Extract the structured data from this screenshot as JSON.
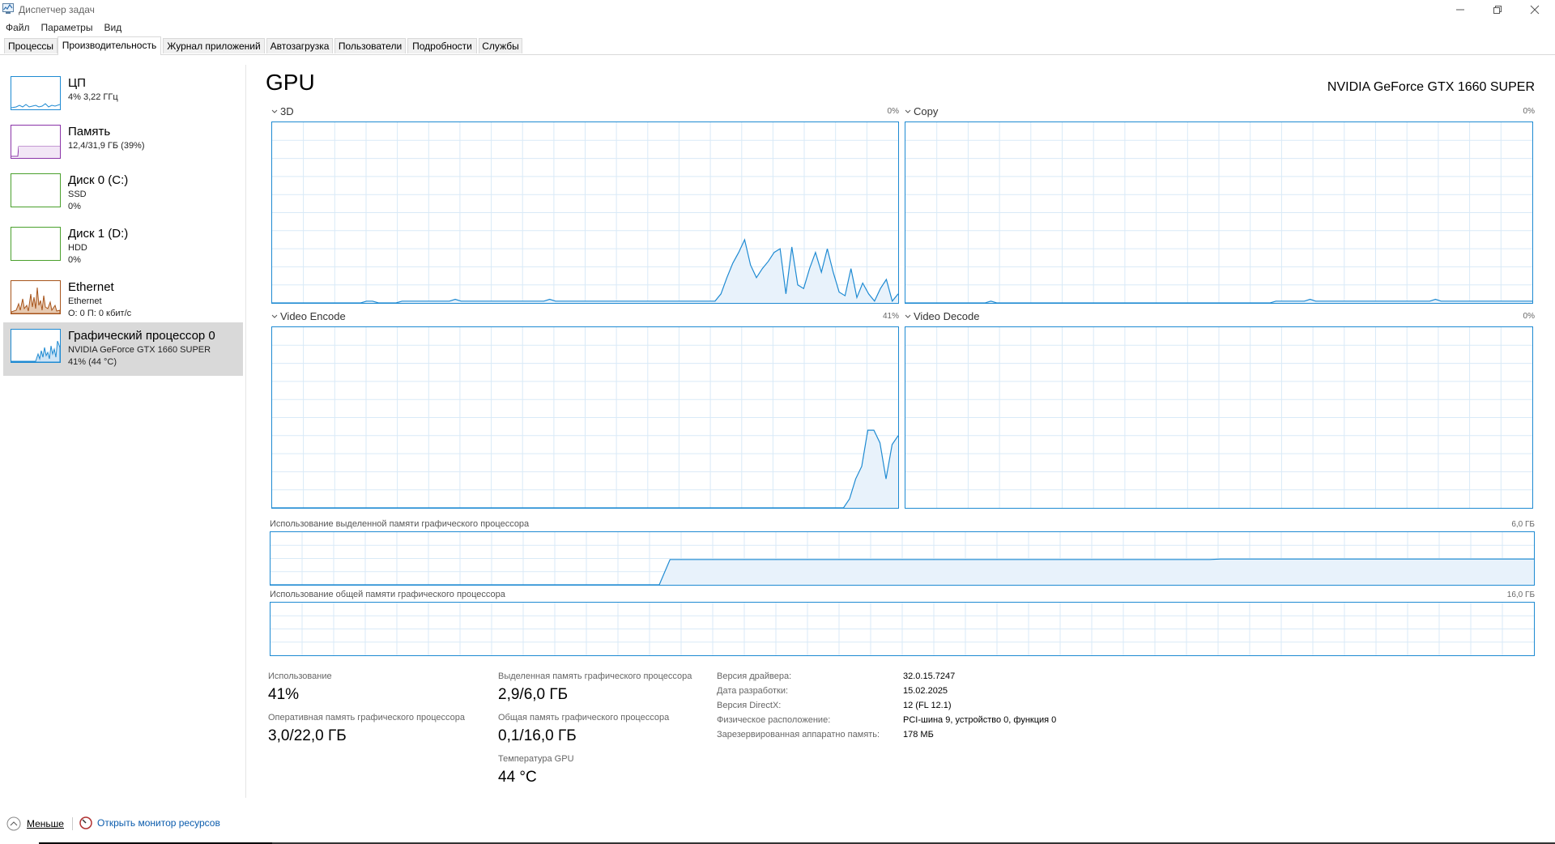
{
  "window": {
    "title": "Диспетчер задач",
    "menu": [
      "Файл",
      "Параметры",
      "Вид"
    ],
    "accent": "#1e8ad2"
  },
  "tabs": [
    "Процессы",
    "Производительность",
    "Журнал приложений",
    "Автозагрузка",
    "Пользователи",
    "Подробности",
    "Службы"
  ],
  "active_tab": "Производительность",
  "sidebar": {
    "items": [
      {
        "title": "ЦП",
        "line1": "4% 3,22 ГГц",
        "line2": "",
        "color": "#1e8ad2"
      },
      {
        "title": "Память",
        "line1": "12,4/31,9 ГБ (39%)",
        "line2": "",
        "color": "#8b34a8"
      },
      {
        "title": "Диск 0 (C:)",
        "line1": "SSD",
        "line2": "0%",
        "color": "#4aa02c"
      },
      {
        "title": "Диск 1 (D:)",
        "line1": "HDD",
        "line2": "0%",
        "color": "#4aa02c"
      },
      {
        "title": "Ethernet",
        "line1": "Ethernet",
        "line2": "О: 0 П: 0 кбит/с",
        "color": "#a7541b"
      },
      {
        "title": "Графический процессор 0",
        "line1": "NVIDIA GeForce GTX 1660 SUPER",
        "line2": "41% (44 °C)",
        "color": "#1e8ad2"
      }
    ]
  },
  "main": {
    "title": "GPU",
    "model": "NVIDIA GeForce GTX 1660 SUPER",
    "engines": [
      {
        "name": "3D",
        "percent": "0%",
        "series": [
          0,
          0,
          0,
          0,
          0,
          0,
          0,
          0,
          0,
          0,
          0,
          0,
          0,
          0,
          0,
          0,
          1,
          1,
          0,
          0,
          0,
          0,
          1,
          1,
          1,
          1,
          1,
          1,
          1,
          1,
          1,
          2,
          1,
          1,
          1,
          1,
          1,
          1,
          1,
          1,
          1,
          1,
          1,
          1,
          1,
          1,
          1,
          2,
          1,
          1,
          1,
          1,
          1,
          1,
          1,
          1,
          1,
          1,
          1,
          1,
          1,
          1,
          1,
          1,
          1,
          1,
          1,
          1,
          1,
          1,
          1,
          1,
          1,
          1,
          1,
          1,
          5,
          14,
          22,
          28,
          35,
          21,
          14,
          19,
          23,
          28,
          30,
          5,
          31,
          10,
          8,
          19,
          28,
          17,
          30,
          17,
          6,
          4,
          19,
          3,
          11,
          5,
          1,
          8,
          13,
          1,
          5
        ]
      },
      {
        "name": "Copy",
        "percent": "0%",
        "series": [
          0,
          0,
          0,
          0,
          0,
          0,
          0,
          0,
          0,
          0,
          0,
          0,
          0,
          0,
          0,
          1,
          0,
          0,
          0,
          0,
          0,
          0,
          0,
          0,
          0,
          0,
          0,
          0,
          0,
          0,
          0,
          0,
          0,
          0,
          0,
          0,
          0,
          0,
          0,
          0,
          0,
          0,
          0,
          0,
          0,
          0,
          0,
          0,
          0,
          0,
          0,
          0,
          0,
          0,
          0,
          0,
          0,
          0,
          0,
          0,
          0,
          0,
          0,
          0,
          0,
          1,
          1,
          1,
          1,
          1,
          1,
          2,
          1,
          1,
          1,
          1,
          1,
          1,
          1,
          1,
          1,
          1,
          1,
          1,
          1,
          1,
          1,
          1,
          1,
          1,
          1,
          1,
          1,
          2,
          1,
          1,
          1,
          1,
          1,
          1,
          1,
          1,
          1,
          1,
          1,
          1,
          1,
          1,
          1,
          1,
          1
        ]
      },
      {
        "name": "Video Encode",
        "percent": "41%",
        "series": [
          0,
          0,
          0,
          0,
          0,
          0,
          0,
          0,
          0,
          0,
          0,
          0,
          0,
          0,
          0,
          0,
          0,
          0,
          0,
          0,
          0,
          0,
          0,
          0,
          0,
          0,
          0,
          0,
          0,
          0,
          0,
          0,
          0,
          0,
          0,
          0,
          0,
          0,
          0,
          0,
          0,
          0,
          0,
          0,
          0,
          0,
          0,
          0,
          0,
          0,
          0,
          0,
          0,
          0,
          0,
          0,
          0,
          0,
          0,
          0,
          0,
          0,
          0,
          0,
          0,
          0,
          0,
          0,
          0,
          0,
          0,
          0,
          0,
          0,
          0,
          0,
          0,
          0,
          0,
          0,
          0,
          0,
          0,
          0,
          0,
          0,
          0,
          0,
          0,
          0,
          0,
          0,
          0,
          0,
          0,
          5,
          16,
          23,
          43,
          43,
          36,
          16,
          35,
          40
        ]
      },
      {
        "name": "Video Decode",
        "percent": "0%",
        "series": []
      }
    ],
    "dedicated_memory": {
      "label": "Использование выделенной памяти графического процессора",
      "max": "6,0 ГБ",
      "series": [
        0,
        0,
        0,
        0,
        0,
        0,
        0,
        0,
        0,
        0,
        0,
        0,
        0,
        0,
        0,
        0,
        0,
        0,
        0,
        0,
        0,
        0,
        0,
        0,
        0,
        0,
        0,
        0,
        0,
        0,
        0,
        0,
        0,
        0,
        0,
        0,
        0,
        48,
        48,
        48,
        48,
        48,
        48,
        48,
        48,
        48,
        48,
        48,
        48,
        48,
        48,
        48,
        48,
        48,
        48,
        48,
        48,
        48,
        48,
        48,
        48,
        48,
        48,
        48,
        48,
        48,
        48,
        48,
        48,
        48,
        48,
        48,
        48,
        48,
        48,
        48,
        48,
        48,
        48,
        48,
        48,
        48,
        48,
        48,
        48,
        48,
        48,
        48,
        49,
        49,
        49,
        49,
        49,
        49,
        49,
        49,
        49,
        49,
        49,
        49,
        49,
        49,
        49,
        49,
        49,
        49,
        49,
        49,
        49,
        49,
        49,
        49,
        49,
        49,
        49,
        49,
        49,
        49
      ]
    },
    "shared_memory": {
      "label": "Использование общей памяти графического процессора",
      "max": "16,0 ГБ",
      "series": []
    },
    "stats": {
      "utilization_label": "Использование",
      "utilization_value": "41%",
      "dedicated_label": "Выделенная память графического процессора",
      "dedicated_value": "2,9/6,0 ГБ",
      "ram_label": "Оперативная память графического процессора",
      "ram_value": "3,0/22,0 ГБ",
      "shared_label": "Общая память графического процессора",
      "shared_value": "0,1/16,0 ГБ",
      "temp_label": "Температура GPU",
      "temp_value": "44 °C"
    },
    "info": [
      {
        "key": "Версия драйвера:",
        "value": "32.0.15.7247"
      },
      {
        "key": "Дата разработки:",
        "value": "15.02.2025"
      },
      {
        "key": "Версия DirectX:",
        "value": "12 (FL 12.1)"
      },
      {
        "key": "Физическое расположение:",
        "value": "PCI-шина 9, устройство 0, функция 0"
      },
      {
        "key": "Зарезервированная аппаратно память:",
        "value": "178 МБ"
      }
    ]
  },
  "footer": {
    "fewer_label": "Меньше",
    "monitor_label": "Открыть монитор ресурсов"
  }
}
